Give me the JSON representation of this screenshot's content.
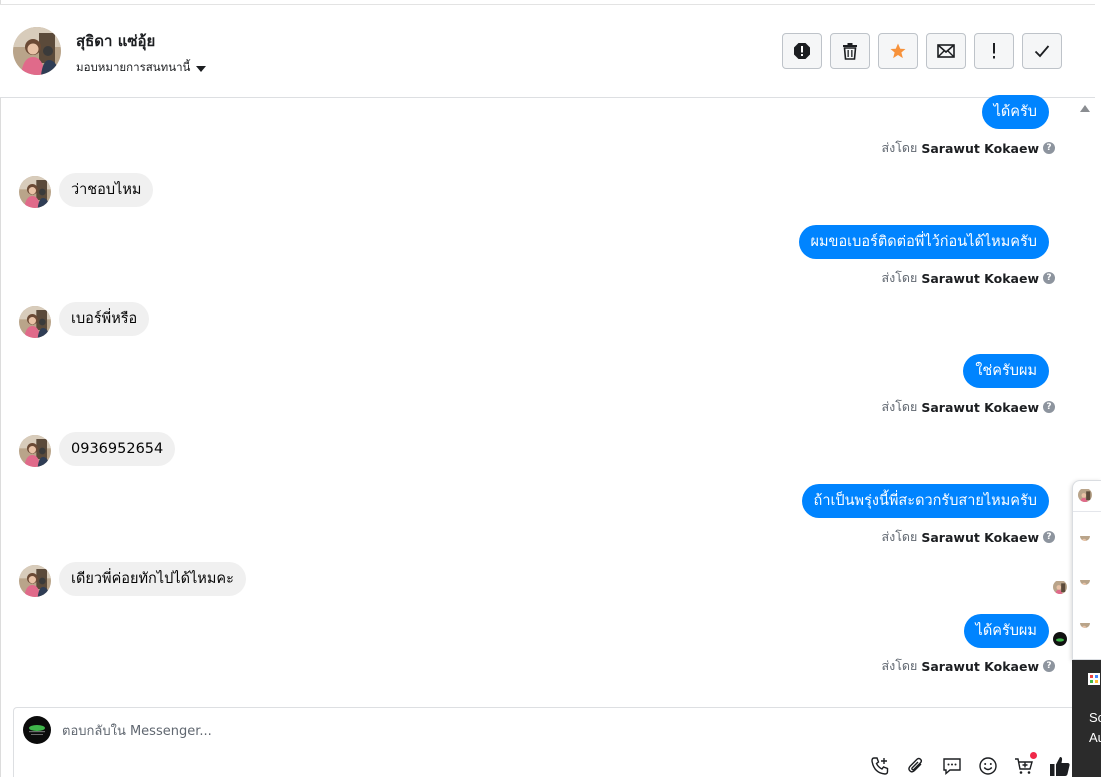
{
  "header": {
    "contact_name": "สุธิดา แซ่อุ้ย",
    "assign_label": "มอบหมายการสนทนานี้",
    "actions": [
      {
        "name": "report-icon",
        "label": "Report spam"
      },
      {
        "name": "trash-icon",
        "label": "Delete"
      },
      {
        "name": "star-icon",
        "label": "Star"
      },
      {
        "name": "envelope-icon",
        "label": "Mark as unread"
      },
      {
        "name": "exclamation-icon",
        "label": "Follow up"
      },
      {
        "name": "check-icon",
        "label": "Mark as done"
      }
    ]
  },
  "messages": [
    {
      "direction": "out",
      "text": "ได้ครับ",
      "sent_by_prefix": "ส่งโดย",
      "sender": "Sarawut Kokaew"
    },
    {
      "direction": "in",
      "text": "ว่าชอบไหม"
    },
    {
      "direction": "out",
      "text": "ผมขอเบอร์ติดต่อพี่ไว้ก่อนได้ไหมครับ",
      "sent_by_prefix": "ส่งโดย",
      "sender": "Sarawut Kokaew"
    },
    {
      "direction": "in",
      "text": "เบอร์พี่หรือ"
    },
    {
      "direction": "out",
      "text": "ใช่ครับผม",
      "sent_by_prefix": "ส่งโดย",
      "sender": "Sarawut Kokaew"
    },
    {
      "direction": "in",
      "text": "0936952654"
    },
    {
      "direction": "out",
      "text": "ถ้าเป็นพรุ่งนี้พี่สะดวกรับสายไหมครับ",
      "sent_by_prefix": "ส่งโดย",
      "sender": "Sarawut Kokaew"
    },
    {
      "direction": "in",
      "text": "เดียวพี่ค่อยทักไปได้ไหมคะ"
    },
    {
      "direction": "out",
      "text": "ได้ครับผม",
      "sent_by_prefix": "ส่งโดย",
      "sender": "Sarawut Kokaew"
    }
  ],
  "composer": {
    "placeholder": "ตอบกลับใน Messenger...",
    "tools": [
      "phone-add-icon",
      "paperclip-icon",
      "saved-reply-icon",
      "emoji-icon",
      "cart-add-icon",
      "like-icon"
    ]
  },
  "side_panel": {
    "dark_text_1": "Sc",
    "dark_text_2": "Au"
  },
  "colors": {
    "outgoing_bubble": "#0084ff",
    "incoming_bubble": "#f0f0f0",
    "star": "#f7923b",
    "notification": "#f02849"
  }
}
